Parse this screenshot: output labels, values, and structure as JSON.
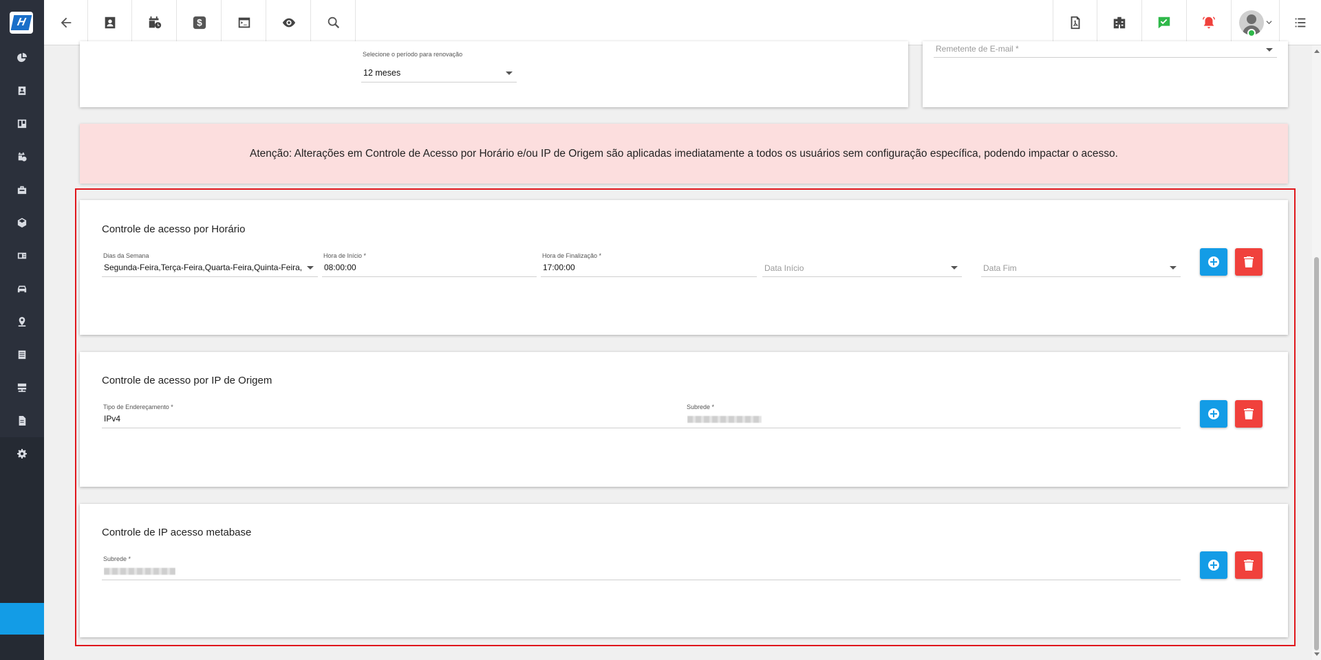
{
  "colors": {
    "accent": "#139ce6",
    "danger": "#f0413c",
    "sidebar_bg": "#2b303b",
    "alert_bg": "#fcdede",
    "highlight_border": "#e0161b"
  },
  "sidebar": {
    "items": [
      {
        "icon": "chart-pie-icon"
      },
      {
        "icon": "contact-card-icon"
      },
      {
        "icon": "board-icon"
      },
      {
        "icon": "calendar-clock-icon"
      },
      {
        "icon": "briefcase-icon"
      },
      {
        "icon": "box-icon"
      },
      {
        "icon": "id-card-icon"
      },
      {
        "icon": "car-icon"
      },
      {
        "icon": "map-pin-icon"
      },
      {
        "icon": "list-doc-icon"
      },
      {
        "icon": "server-icon"
      },
      {
        "icon": "document-icon"
      },
      {
        "icon": "gear-icon"
      }
    ]
  },
  "topbar": {
    "left_icons": [
      "back-arrow-icon",
      "contact-icon",
      "calendar-clock-icon",
      "dollar-icon",
      "terminal-icon",
      "eye-icon",
      "search-icon"
    ],
    "right_icons": [
      "pdf-icon",
      "building-icon",
      "chat-check-icon",
      "alarm-bell-icon",
      "user-avatar",
      "menu-list-icon"
    ]
  },
  "top_card": {
    "renewal_label": "Selecione o período para renovação",
    "renewal_value": "12 meses",
    "email_sender_placeholder": "Remetente de E-mail *"
  },
  "alert": {
    "text": "Atenção: Alterações em Controle de Acesso por Horário e/ou IP de Origem são aplicadas imediatamente a todos os usuários sem configuração específica, podendo impactar o acesso."
  },
  "horario_card": {
    "title": "Controle de acesso por Horário",
    "dias_label": "Dias da Semana",
    "dias_value": "Segunda-Feira,Terça-Feira,Quarta-Feira,Quinta-Feira,Sexta-Feira",
    "hora_inicio_label": "Hora de Início *",
    "hora_inicio_value": "08:00:00",
    "hora_fim_label": "Hora de Finalização *",
    "hora_fim_value": "17:00:00",
    "data_inicio_placeholder": "Data Início",
    "data_fim_placeholder": "Data Fim"
  },
  "ip_card": {
    "title": "Controle de acesso por IP de Origem",
    "tipo_label": "Tipo de Endereçamento *",
    "tipo_value": "IPv4",
    "subrede_label": "Subrede *"
  },
  "metabase_card": {
    "title": "Controle de IP acesso metabase",
    "subrede_label": "Subrede *"
  }
}
